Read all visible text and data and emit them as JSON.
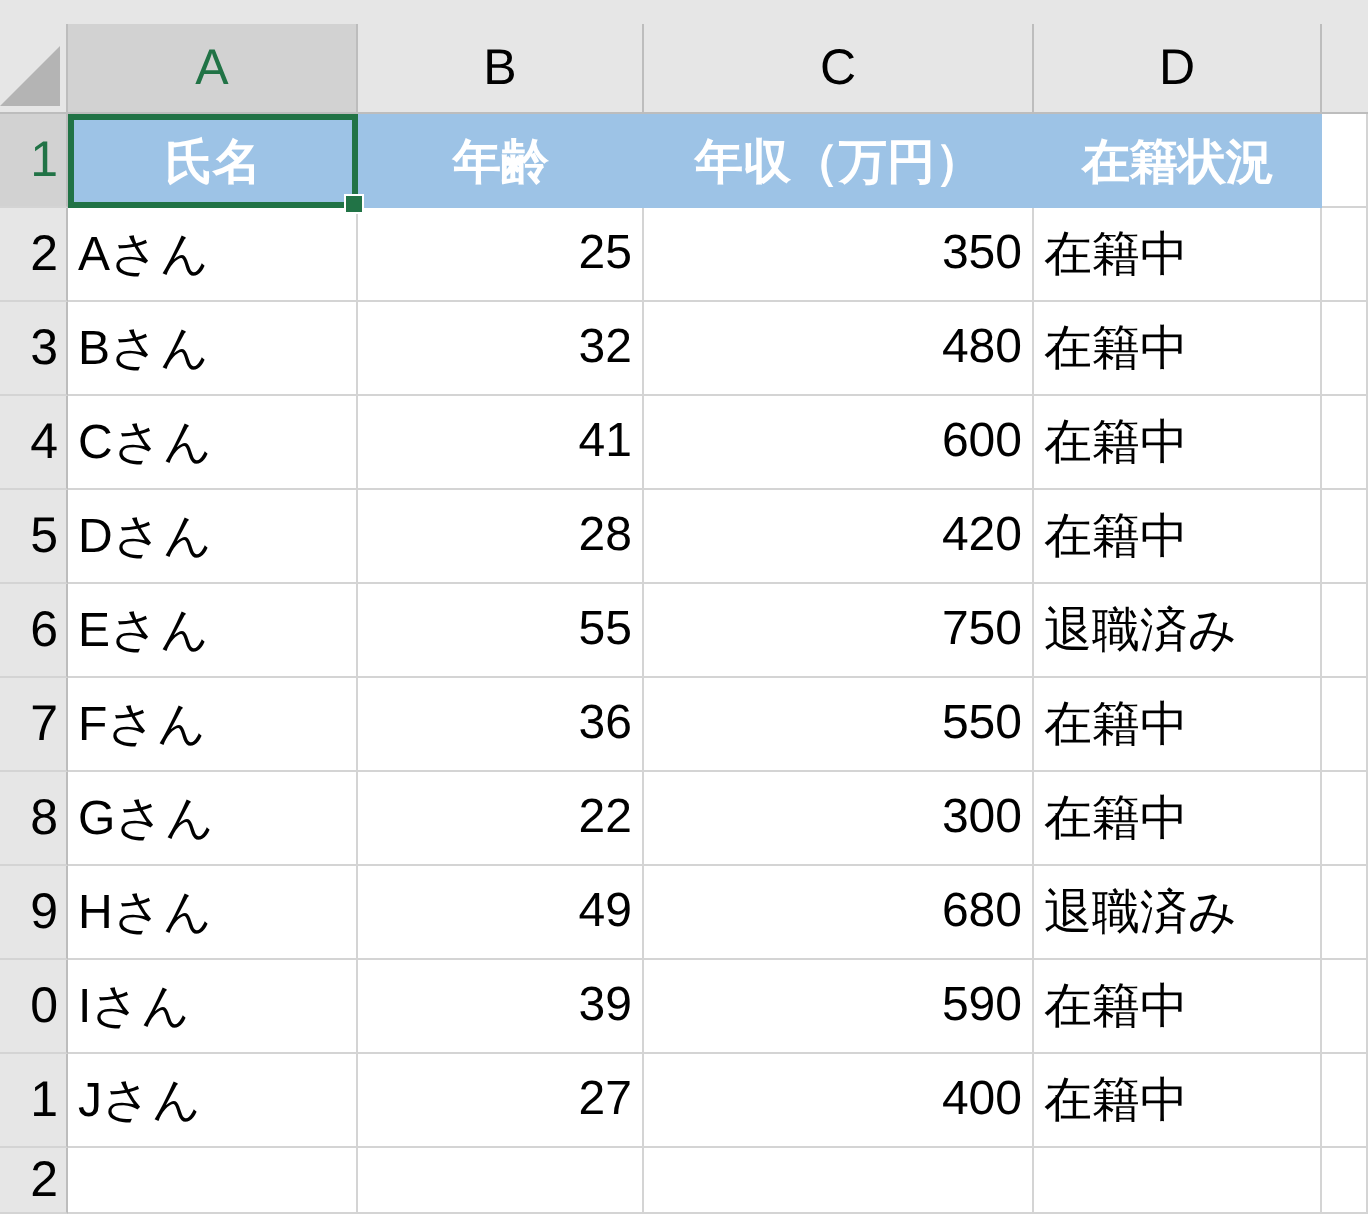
{
  "columns": [
    {
      "label": "A",
      "selected": true,
      "kind": "text"
    },
    {
      "label": "B",
      "selected": false,
      "kind": "number"
    },
    {
      "label": "C",
      "selected": false,
      "kind": "number"
    },
    {
      "label": "D",
      "selected": false,
      "kind": "text"
    }
  ],
  "header_row": {
    "number": "1",
    "selected": true,
    "cells": [
      {
        "text": "氏名",
        "selected": true
      },
      {
        "text": "年齢",
        "selected": false
      },
      {
        "text": "年収（万円）",
        "selected": false
      },
      {
        "text": "在籍状況",
        "selected": false
      }
    ]
  },
  "rows": [
    {
      "number": "2",
      "cells": [
        "Aさん",
        "25",
        "350",
        "在籍中"
      ]
    },
    {
      "number": "3",
      "cells": [
        "Bさん",
        "32",
        "480",
        "在籍中"
      ]
    },
    {
      "number": "4",
      "cells": [
        "Cさん",
        "41",
        "600",
        "在籍中"
      ]
    },
    {
      "number": "5",
      "cells": [
        "Dさん",
        "28",
        "420",
        "在籍中"
      ]
    },
    {
      "number": "6",
      "cells": [
        "Eさん",
        "55",
        "750",
        "退職済み"
      ]
    },
    {
      "number": "7",
      "cells": [
        "Fさん",
        "36",
        "550",
        "在籍中"
      ]
    },
    {
      "number": "8",
      "cells": [
        "Gさん",
        "22",
        "300",
        "在籍中"
      ]
    },
    {
      "number": "9",
      "cells": [
        "Hさん",
        "49",
        "680",
        "退職済み"
      ]
    },
    {
      "number": "0",
      "cells": [
        "Iさん",
        "39",
        "590",
        "在籍中"
      ]
    },
    {
      "number": "1",
      "cells": [
        "Jさん",
        "27",
        "400",
        "在籍中"
      ]
    },
    {
      "number": "2",
      "cells": []
    }
  ]
}
